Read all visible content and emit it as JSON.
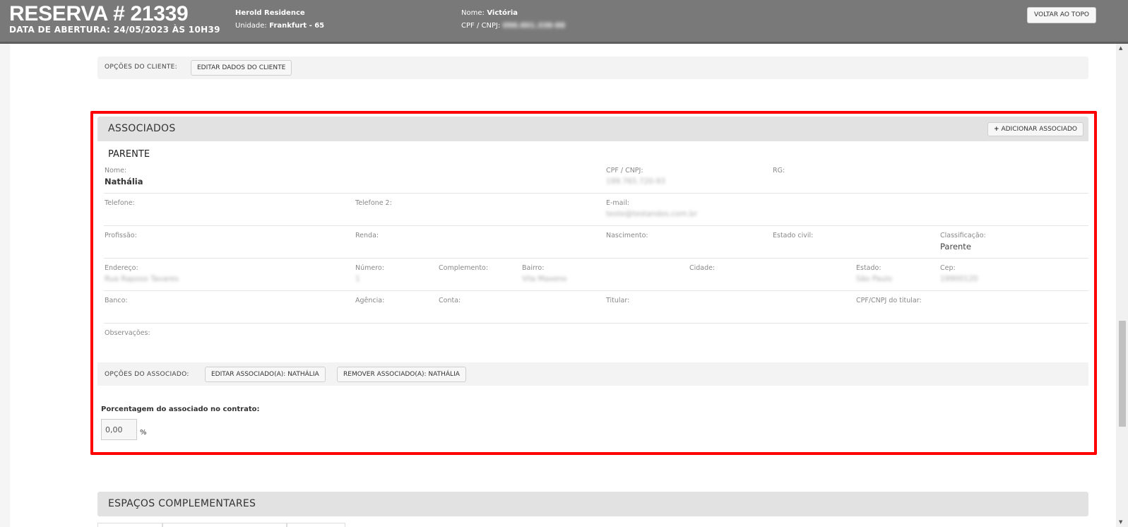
{
  "header": {
    "title": "RESERVA # 21339",
    "opening_date": "DATA DE ABERTURA: 24/05/2023 ÀS 10H39",
    "property_name": "Herold Residence",
    "unit_label": "Unidade:",
    "unit_value": "Frankfurt - 65",
    "client_name_label": "Nome:",
    "client_name_value": "Victória",
    "client_doc_label": "CPF / CNPJ:",
    "client_doc_value": "096.601.338-88",
    "back_to_top": "VOLTAR AO TOPO"
  },
  "client_options": {
    "label": "OPÇÕES DO CLIENTE:",
    "edit_button": "EDITAR DADOS DO CLIENTE"
  },
  "associates": {
    "section_title": "ASSOCIADOS",
    "add_button": "ADICIONAR ASSOCIADO",
    "relation_title": "PARENTE",
    "fields": {
      "nome_label": "Nome:",
      "nome_value": "Nathália",
      "cpf_label": "CPF / CNPJ:",
      "cpf_value": "199.765.720-93",
      "rg_label": "RG:",
      "telefone_label": "Telefone:",
      "telefone2_label": "Telefone 2:",
      "email_label": "E-mail:",
      "email_value": "teste@testandos.com.br",
      "profissao_label": "Profissão:",
      "renda_label": "Renda:",
      "nascimento_label": "Nascimento:",
      "estado_civil_label": "Estado civil:",
      "classificacao_label": "Classificação:",
      "classificacao_value": "Parente",
      "endereco_label": "Endereço:",
      "endereco_value": "Rua Raposo Tavares",
      "numero_label": "Número:",
      "numero_value": "1",
      "complemento_label": "Complemento:",
      "bairro_label": "Bairro:",
      "bairro_value": "Vila Maxeno",
      "cidade_label": "Cidade:",
      "estado_label": "Estado:",
      "estado_value": "São Paulo",
      "cep_label": "Cep:",
      "cep_value": "19900120",
      "banco_label": "Banco:",
      "agencia_label": "Agência:",
      "conta_label": "Conta:",
      "titular_label": "Titular:",
      "cpf_titular_label": "CPF/CNPJ do titular:",
      "observacoes_label": "Observações:"
    },
    "options_label": "OPÇÕES DO ASSOCIADO:",
    "edit_button": "EDITAR ASSOCIADO(A): NATHÁLIA",
    "remove_button": "REMOVER ASSOCIADO(A): NATHÁLIA",
    "percentage_label": "Porcentagem do associado no contrato:",
    "percentage_value": "0,00",
    "percentage_sign": "%"
  },
  "complementary": {
    "section_title": "ESPAÇOS COMPLEMENTARES"
  },
  "icons": {
    "plus": "plus-icon",
    "scroll_up": "arrow-up-icon",
    "scroll_down": "arrow-down-icon"
  },
  "colors": {
    "header_bg": "#797979",
    "highlight_border": "#ff0000",
    "section_head_bg": "#e2e2e2"
  }
}
